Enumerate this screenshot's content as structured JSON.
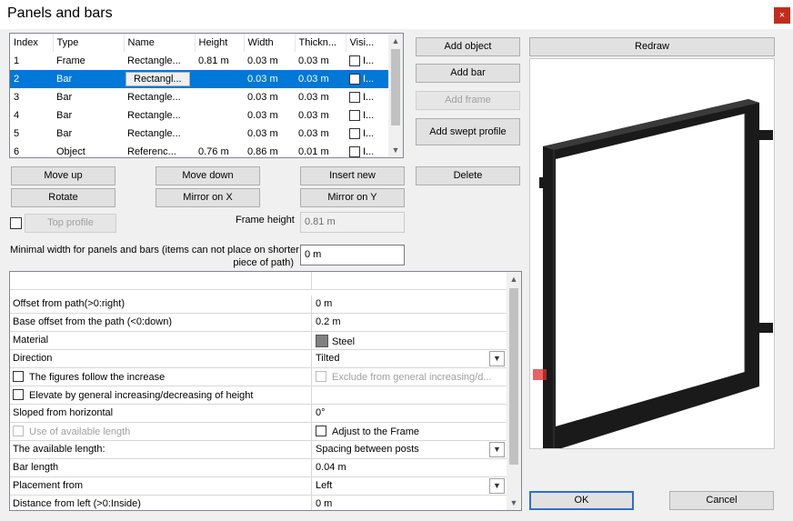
{
  "window": {
    "title": "Panels and bars",
    "close_glyph": "×"
  },
  "grid": {
    "columns": [
      "Index",
      "Type",
      "Name",
      "Height",
      "Width",
      "Thickn...",
      "Visi..."
    ],
    "rows": [
      {
        "index": "1",
        "type": "Frame",
        "name": "Rectangle...",
        "height": "0.81 m",
        "width": "0.03 m",
        "thick": "0.03 m",
        "vis": "I..."
      },
      {
        "index": "2",
        "type": "Bar",
        "name": "Rectangl...",
        "height": "",
        "width": "0.03 m",
        "thick": "0.03 m",
        "vis": "I..."
      },
      {
        "index": "3",
        "type": "Bar",
        "name": "Rectangle...",
        "height": "",
        "width": "0.03 m",
        "thick": "0.03 m",
        "vis": "I..."
      },
      {
        "index": "4",
        "type": "Bar",
        "name": "Rectangle...",
        "height": "",
        "width": "0.03 m",
        "thick": "0.03 m",
        "vis": "I..."
      },
      {
        "index": "5",
        "type": "Bar",
        "name": "Rectangle...",
        "height": "",
        "width": "0.03 m",
        "thick": "0.03 m",
        "vis": "I..."
      },
      {
        "index": "6",
        "type": "Object",
        "name": "Referenc...",
        "height": "0.76 m",
        "width": "0.86 m",
        "thick": "0.01 m",
        "vis": "I..."
      }
    ],
    "selected_row": 1
  },
  "buttons": {
    "add_object": "Add object",
    "add_bar": "Add bar",
    "add_frame": "Add frame",
    "add_swept_profile": "Add swept profile",
    "delete": "Delete",
    "move_up": "Move up",
    "move_down": "Move down",
    "insert_new": "Insert new",
    "rotate": "Rotate",
    "mirror_x": "Mirror on X",
    "mirror_y": "Mirror on Y",
    "top_profile": "Top profile",
    "redraw": "Redraw",
    "ok": "OK",
    "cancel": "Cancel"
  },
  "frame_height": {
    "label": "Frame height",
    "value": "0.81 m"
  },
  "minimal_width": {
    "label_line1": "Minimal width for panels and bars (items can not place on shorter",
    "label_line2": "piece of path)",
    "value": "0 m"
  },
  "props": {
    "rows": [
      {
        "label": "",
        "value": ""
      },
      {
        "label": "Offset from path(>0:right)",
        "value": "0 m"
      },
      {
        "label": "Base offset from the path (<0:down)",
        "value": "0.2 m"
      },
      {
        "label": "Material",
        "value": "Steel"
      },
      {
        "label": "Direction",
        "value": "Tilted"
      },
      {
        "label": "The figures follow the increase",
        "value": "Exclude from general increasing/d..."
      },
      {
        "label": "Elevate by general increasing/decreasing of height",
        "value": ""
      },
      {
        "label": "Sloped from horizontal",
        "value": "0°"
      },
      {
        "label": "Use of available length",
        "value": "Adjust to the Frame"
      },
      {
        "label": "The available length:",
        "value": "Spacing between posts"
      },
      {
        "label": "Bar length",
        "value": "0.04 m"
      },
      {
        "label": "Placement from",
        "value": "Left"
      },
      {
        "label": "Distance from left (>0:Inside)",
        "value": "0 m"
      }
    ]
  },
  "icons": {
    "dropdown": "chevron-down-icon",
    "scroll_up": "chevron-up-icon",
    "scroll_down": "chevron-down-icon"
  },
  "colors": {
    "selection": "#0078d7",
    "close": "#c42b1c",
    "frame": "#1a1a1a",
    "marker": "#e03030"
  }
}
